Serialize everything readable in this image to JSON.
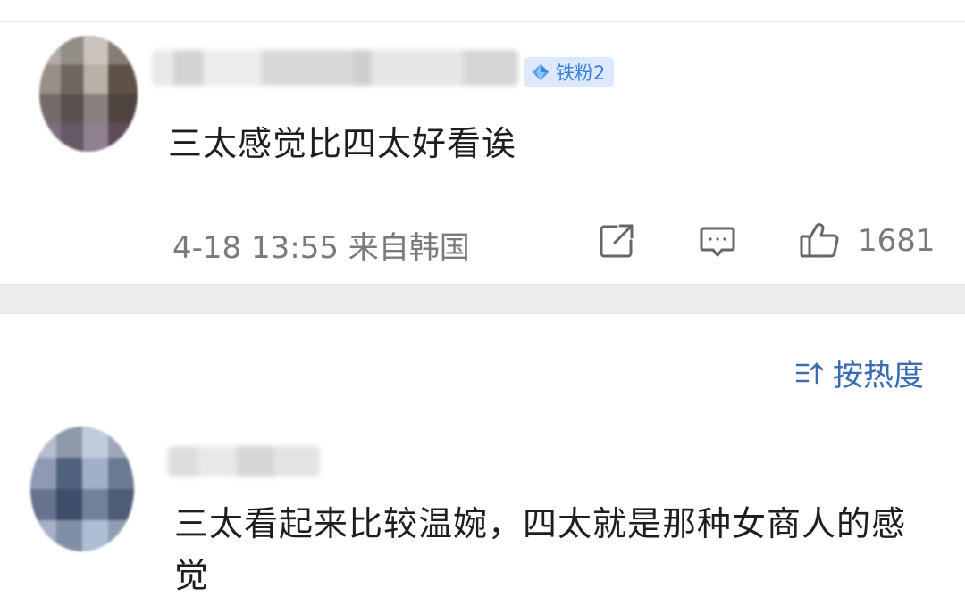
{
  "comments": [
    {
      "badge": "铁粉2",
      "text": "三太感觉比四太好看诶",
      "meta": "4-18 13:55 来自韩国",
      "likes": "1681"
    },
    {
      "text": "三太看起来比较温婉，四太就是那种女商人的感觉"
    }
  ],
  "sort": {
    "label": "按热度"
  },
  "icons": {
    "badge": "diamond-icon",
    "share": "share-icon",
    "comment": "comment-icon",
    "like": "thumbs-up-icon",
    "sort": "sort-icon"
  },
  "colors": {
    "badge_bg": "#dbe9fb",
    "badge_text": "#3a7fde",
    "sort_text": "#3a6cb5",
    "meta_text": "#7a7a7a"
  }
}
